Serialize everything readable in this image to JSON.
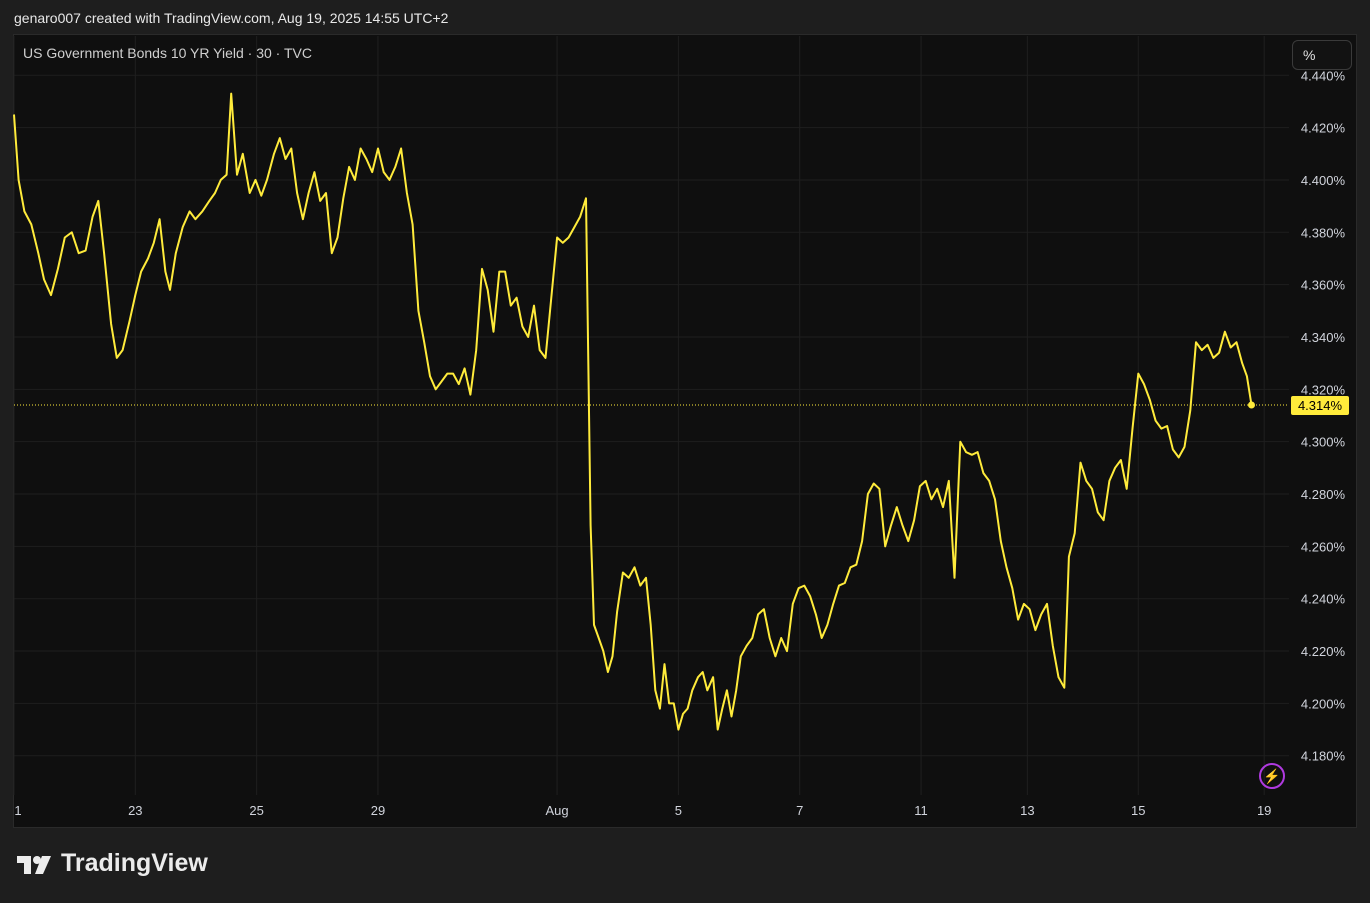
{
  "header": {
    "credit": "genaro007 created with TradingView.com, Aug 19, 2025 14:55 UTC+2"
  },
  "chart": {
    "title": "US Government Bonds 10 YR Yield · 30 · TVC",
    "scale_button": "%",
    "last_price_label": "4.314%"
  },
  "footer": {
    "brand": "TradingView"
  },
  "colors": {
    "line": "#ffeb3b",
    "background": "#0f0f0f",
    "grid": "#1f1f1f",
    "accent_bolt": "#b03ae0"
  },
  "chart_data": {
    "type": "line",
    "title": "US Government Bonds 10 YR Yield · 30 · TVC",
    "y_unit": "%",
    "ylim": [
      4.165,
      4.455
    ],
    "y_ticks": [
      "4.180%",
      "4.200%",
      "4.220%",
      "4.240%",
      "4.260%",
      "4.280%",
      "4.300%",
      "4.320%",
      "4.340%",
      "4.360%",
      "4.380%",
      "4.400%",
      "4.420%",
      "4.440%"
    ],
    "x_tick_labels": [
      {
        "label": "1",
        "x": 0
      },
      {
        "label": "23",
        "x": 10.5
      },
      {
        "label": "25",
        "x": 21
      },
      {
        "label": "29",
        "x": 31.5
      },
      {
        "label": "Aug",
        "x": 47
      },
      {
        "label": "5",
        "x": 57.5
      },
      {
        "label": "7",
        "x": 68
      },
      {
        "label": "11",
        "x": 78.5
      },
      {
        "label": "13",
        "x": 87.7
      },
      {
        "label": "15",
        "x": 97.3
      },
      {
        "label": "19",
        "x": 108.2
      }
    ],
    "last_value": 4.314,
    "grid": true,
    "series": [
      {
        "points": [
          [
            0,
            4.425
          ],
          [
            0.4,
            4.4
          ],
          [
            0.9,
            4.388
          ],
          [
            1.5,
            4.383
          ],
          [
            2.1,
            4.372
          ],
          [
            2.6,
            4.362
          ],
          [
            3.2,
            4.356
          ],
          [
            3.8,
            4.366
          ],
          [
            4.4,
            4.378
          ],
          [
            5.0,
            4.38
          ],
          [
            5.6,
            4.372
          ],
          [
            6.2,
            4.373
          ],
          [
            6.8,
            4.386
          ],
          [
            7.3,
            4.392
          ],
          [
            7.8,
            4.372
          ],
          [
            8.4,
            4.345
          ],
          [
            8.9,
            4.332
          ],
          [
            9.4,
            4.335
          ],
          [
            10.0,
            4.346
          ],
          [
            10.5,
            4.356
          ],
          [
            11.0,
            4.365
          ],
          [
            11.6,
            4.37
          ],
          [
            12.1,
            4.376
          ],
          [
            12.6,
            4.385
          ],
          [
            13.1,
            4.365
          ],
          [
            13.5,
            4.358
          ],
          [
            14.0,
            4.372
          ],
          [
            14.6,
            4.382
          ],
          [
            15.2,
            4.388
          ],
          [
            15.7,
            4.385
          ],
          [
            16.3,
            4.388
          ],
          [
            16.9,
            4.392
          ],
          [
            17.4,
            4.395
          ],
          [
            17.9,
            4.4
          ],
          [
            18.4,
            4.402
          ],
          [
            18.8,
            4.433
          ],
          [
            19.3,
            4.402
          ],
          [
            19.8,
            4.41
          ],
          [
            20.4,
            4.395
          ],
          [
            20.9,
            4.4
          ],
          [
            21.4,
            4.394
          ],
          [
            21.9,
            4.4
          ],
          [
            22.5,
            4.41
          ],
          [
            23.0,
            4.416
          ],
          [
            23.5,
            4.408
          ],
          [
            24.0,
            4.412
          ],
          [
            24.5,
            4.395
          ],
          [
            25.0,
            4.385
          ],
          [
            25.5,
            4.395
          ],
          [
            26.0,
            4.403
          ],
          [
            26.5,
            4.392
          ],
          [
            27.0,
            4.395
          ],
          [
            27.5,
            4.372
          ],
          [
            28.0,
            4.378
          ],
          [
            28.5,
            4.393
          ],
          [
            29.0,
            4.405
          ],
          [
            29.5,
            4.4
          ],
          [
            30.0,
            4.412
          ],
          [
            30.5,
            4.408
          ],
          [
            31.0,
            4.403
          ],
          [
            31.5,
            4.412
          ],
          [
            32.0,
            4.403
          ],
          [
            32.5,
            4.4
          ],
          [
            33.0,
            4.405
          ],
          [
            33.5,
            4.412
          ],
          [
            34.0,
            4.395
          ],
          [
            34.5,
            4.383
          ],
          [
            35.0,
            4.35
          ],
          [
            35.5,
            4.338
          ],
          [
            36.0,
            4.325
          ],
          [
            36.5,
            4.32
          ],
          [
            37.0,
            4.323
          ],
          [
            37.5,
            4.326
          ],
          [
            38.0,
            4.326
          ],
          [
            38.5,
            4.322
          ],
          [
            39.0,
            4.328
          ],
          [
            39.5,
            4.318
          ],
          [
            40.0,
            4.335
          ],
          [
            40.5,
            4.366
          ],
          [
            41.0,
            4.358
          ],
          [
            41.5,
            4.342
          ],
          [
            42.0,
            4.365
          ],
          [
            42.5,
            4.365
          ],
          [
            43.0,
            4.352
          ],
          [
            43.5,
            4.355
          ],
          [
            44.0,
            4.344
          ],
          [
            44.5,
            4.34
          ],
          [
            45.0,
            4.352
          ],
          [
            45.5,
            4.335
          ],
          [
            46.0,
            4.332
          ],
          [
            46.5,
            4.355
          ],
          [
            47.0,
            4.378
          ],
          [
            47.5,
            4.376
          ],
          [
            48.0,
            4.378
          ],
          [
            48.5,
            4.382
          ],
          [
            49.0,
            4.386
          ],
          [
            49.5,
            4.393
          ],
          [
            49.9,
            4.268
          ],
          [
            50.2,
            4.23
          ],
          [
            50.6,
            4.225
          ],
          [
            51.0,
            4.22
          ],
          [
            51.4,
            4.212
          ],
          [
            51.8,
            4.218
          ],
          [
            52.2,
            4.235
          ],
          [
            52.7,
            4.25
          ],
          [
            53.2,
            4.248
          ],
          [
            53.7,
            4.252
          ],
          [
            54.2,
            4.245
          ],
          [
            54.7,
            4.248
          ],
          [
            55.1,
            4.23
          ],
          [
            55.5,
            4.205
          ],
          [
            55.9,
            4.198
          ],
          [
            56.3,
            4.215
          ],
          [
            56.7,
            4.2
          ],
          [
            57.1,
            4.2
          ],
          [
            57.5,
            4.19
          ],
          [
            57.9,
            4.196
          ],
          [
            58.3,
            4.198
          ],
          [
            58.7,
            4.205
          ],
          [
            59.2,
            4.21
          ],
          [
            59.6,
            4.212
          ],
          [
            60.0,
            4.205
          ],
          [
            60.5,
            4.21
          ],
          [
            60.9,
            4.19
          ],
          [
            61.3,
            4.198
          ],
          [
            61.7,
            4.205
          ],
          [
            62.1,
            4.195
          ],
          [
            62.5,
            4.205
          ],
          [
            62.9,
            4.218
          ],
          [
            63.4,
            4.222
          ],
          [
            63.9,
            4.225
          ],
          [
            64.4,
            4.234
          ],
          [
            64.9,
            4.236
          ],
          [
            65.4,
            4.225
          ],
          [
            65.9,
            4.218
          ],
          [
            66.4,
            4.225
          ],
          [
            66.9,
            4.22
          ],
          [
            67.4,
            4.238
          ],
          [
            67.9,
            4.244
          ],
          [
            68.4,
            4.245
          ],
          [
            68.9,
            4.241
          ],
          [
            69.4,
            4.234
          ],
          [
            69.9,
            4.225
          ],
          [
            70.4,
            4.23
          ],
          [
            70.9,
            4.238
          ],
          [
            71.4,
            4.245
          ],
          [
            71.9,
            4.246
          ],
          [
            72.4,
            4.252
          ],
          [
            72.9,
            4.253
          ],
          [
            73.4,
            4.262
          ],
          [
            73.9,
            4.28
          ],
          [
            74.4,
            4.284
          ],
          [
            74.9,
            4.282
          ],
          [
            75.4,
            4.26
          ],
          [
            75.9,
            4.268
          ],
          [
            76.4,
            4.275
          ],
          [
            76.9,
            4.268
          ],
          [
            77.4,
            4.262
          ],
          [
            77.9,
            4.27
          ],
          [
            78.4,
            4.283
          ],
          [
            78.9,
            4.285
          ],
          [
            79.4,
            4.278
          ],
          [
            79.9,
            4.282
          ],
          [
            80.4,
            4.275
          ],
          [
            80.9,
            4.285
          ],
          [
            81.4,
            4.248
          ],
          [
            81.9,
            4.3
          ],
          [
            82.4,
            4.296
          ],
          [
            82.9,
            4.295
          ],
          [
            83.4,
            4.296
          ],
          [
            83.9,
            4.288
          ],
          [
            84.4,
            4.285
          ],
          [
            84.9,
            4.278
          ],
          [
            85.4,
            4.262
          ],
          [
            85.9,
            4.252
          ],
          [
            86.4,
            4.244
          ],
          [
            86.9,
            4.232
          ],
          [
            87.4,
            4.238
          ],
          [
            87.9,
            4.236
          ],
          [
            88.4,
            4.228
          ],
          [
            88.9,
            4.234
          ],
          [
            89.4,
            4.238
          ],
          [
            89.9,
            4.222
          ],
          [
            90.4,
            4.21
          ],
          [
            90.9,
            4.206
          ],
          [
            91.3,
            4.256
          ],
          [
            91.8,
            4.265
          ],
          [
            92.3,
            4.292
          ],
          [
            92.8,
            4.285
          ],
          [
            93.3,
            4.282
          ],
          [
            93.8,
            4.273
          ],
          [
            94.3,
            4.27
          ],
          [
            94.8,
            4.285
          ],
          [
            95.3,
            4.29
          ],
          [
            95.8,
            4.293
          ],
          [
            96.3,
            4.282
          ],
          [
            96.8,
            4.305
          ],
          [
            97.3,
            4.326
          ],
          [
            97.8,
            4.322
          ],
          [
            98.3,
            4.316
          ],
          [
            98.8,
            4.308
          ],
          [
            99.3,
            4.305
          ],
          [
            99.8,
            4.306
          ],
          [
            100.3,
            4.297
          ],
          [
            100.8,
            4.294
          ],
          [
            101.3,
            4.298
          ],
          [
            101.8,
            4.312
          ],
          [
            102.3,
            4.338
          ],
          [
            102.8,
            4.335
          ],
          [
            103.3,
            4.337
          ],
          [
            103.8,
            4.332
          ],
          [
            104.3,
            4.334
          ],
          [
            104.8,
            4.342
          ],
          [
            105.3,
            4.336
          ],
          [
            105.8,
            4.338
          ],
          [
            106.3,
            4.33
          ],
          [
            106.7,
            4.325
          ],
          [
            107.1,
            4.314
          ]
        ]
      }
    ]
  }
}
